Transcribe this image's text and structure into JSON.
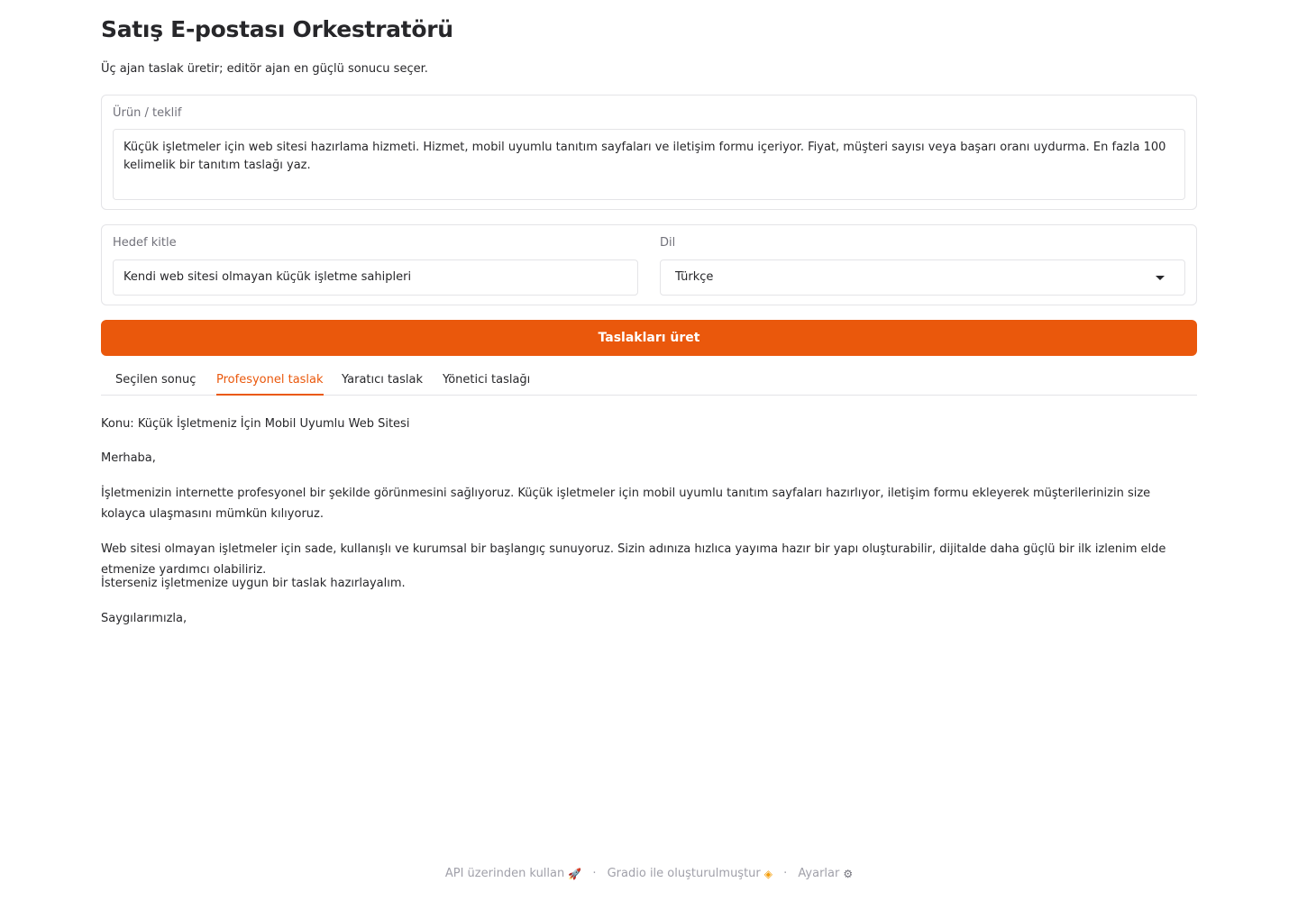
{
  "header": {
    "title": "Satış E-postası Orkestratörü",
    "subtitle": "Üç ajan taslak üretir; editör ajan en güçlü sonucu seçer."
  },
  "product": {
    "label": "Ürün / teklif",
    "value": "Küçük işletmeler için web sitesi hazırlama hizmeti. Hizmet, mobil uyumlu tanıtım sayfaları ve iletişim formu içeriyor. Fiyat, müşteri sayısı veya başarı oranı uydurma. En fazla 100 kelimelik bir tanıtım taslağı yaz."
  },
  "audience": {
    "label": "Hedef kitle",
    "value": "Kendi web sitesi olmayan küçük işletme sahipleri"
  },
  "language": {
    "label": "Dil",
    "selected": "Türkçe"
  },
  "generate_button": "Taslakları üret",
  "tabs": [
    {
      "label": "Seçilen sonuç"
    },
    {
      "label": "Profesyonel taslak",
      "active": true
    },
    {
      "label": "Yaratıcı taslak"
    },
    {
      "label": "Yönetici taslağı"
    }
  ],
  "output": {
    "subject": "Konu: Küçük İşletmeniz İçin Mobil Uyumlu Web Sitesi",
    "greeting": "Merhaba,",
    "para1": "İşletmenizin internette profesyonel bir şekilde görünmesini sağlıyoruz. Küçük işletmeler için mobil uyumlu tanıtım sayfaları hazırlıyor, iletişim formu ekleyerek müşterilerinizin size kolayca ulaşmasını mümkün kılıyoruz.",
    "para2": "Web sitesi olmayan işletmeler için sade, kullanışlı ve kurumsal bir başlangıç sunuyoruz. Sizin adınıza hızlıca yayıma hazır bir yapı oluşturabilir, dijitalde daha güçlü bir ilk izlenim elde etmenize yardımcı olabiliriz.",
    "para3": "İsterseniz işletmenize uygun bir taslak hazırlayalım.",
    "closing": "Saygılarımızla,"
  },
  "footer": {
    "api_link": "API üzerinden kullan",
    "built_with": "Gradio ile oluşturulmuştur",
    "settings": "Ayarlar",
    "separator": "·"
  },
  "colors": {
    "accent": "#ea580c",
    "border": "#e4e4e7",
    "muted_text": "#71717a"
  }
}
